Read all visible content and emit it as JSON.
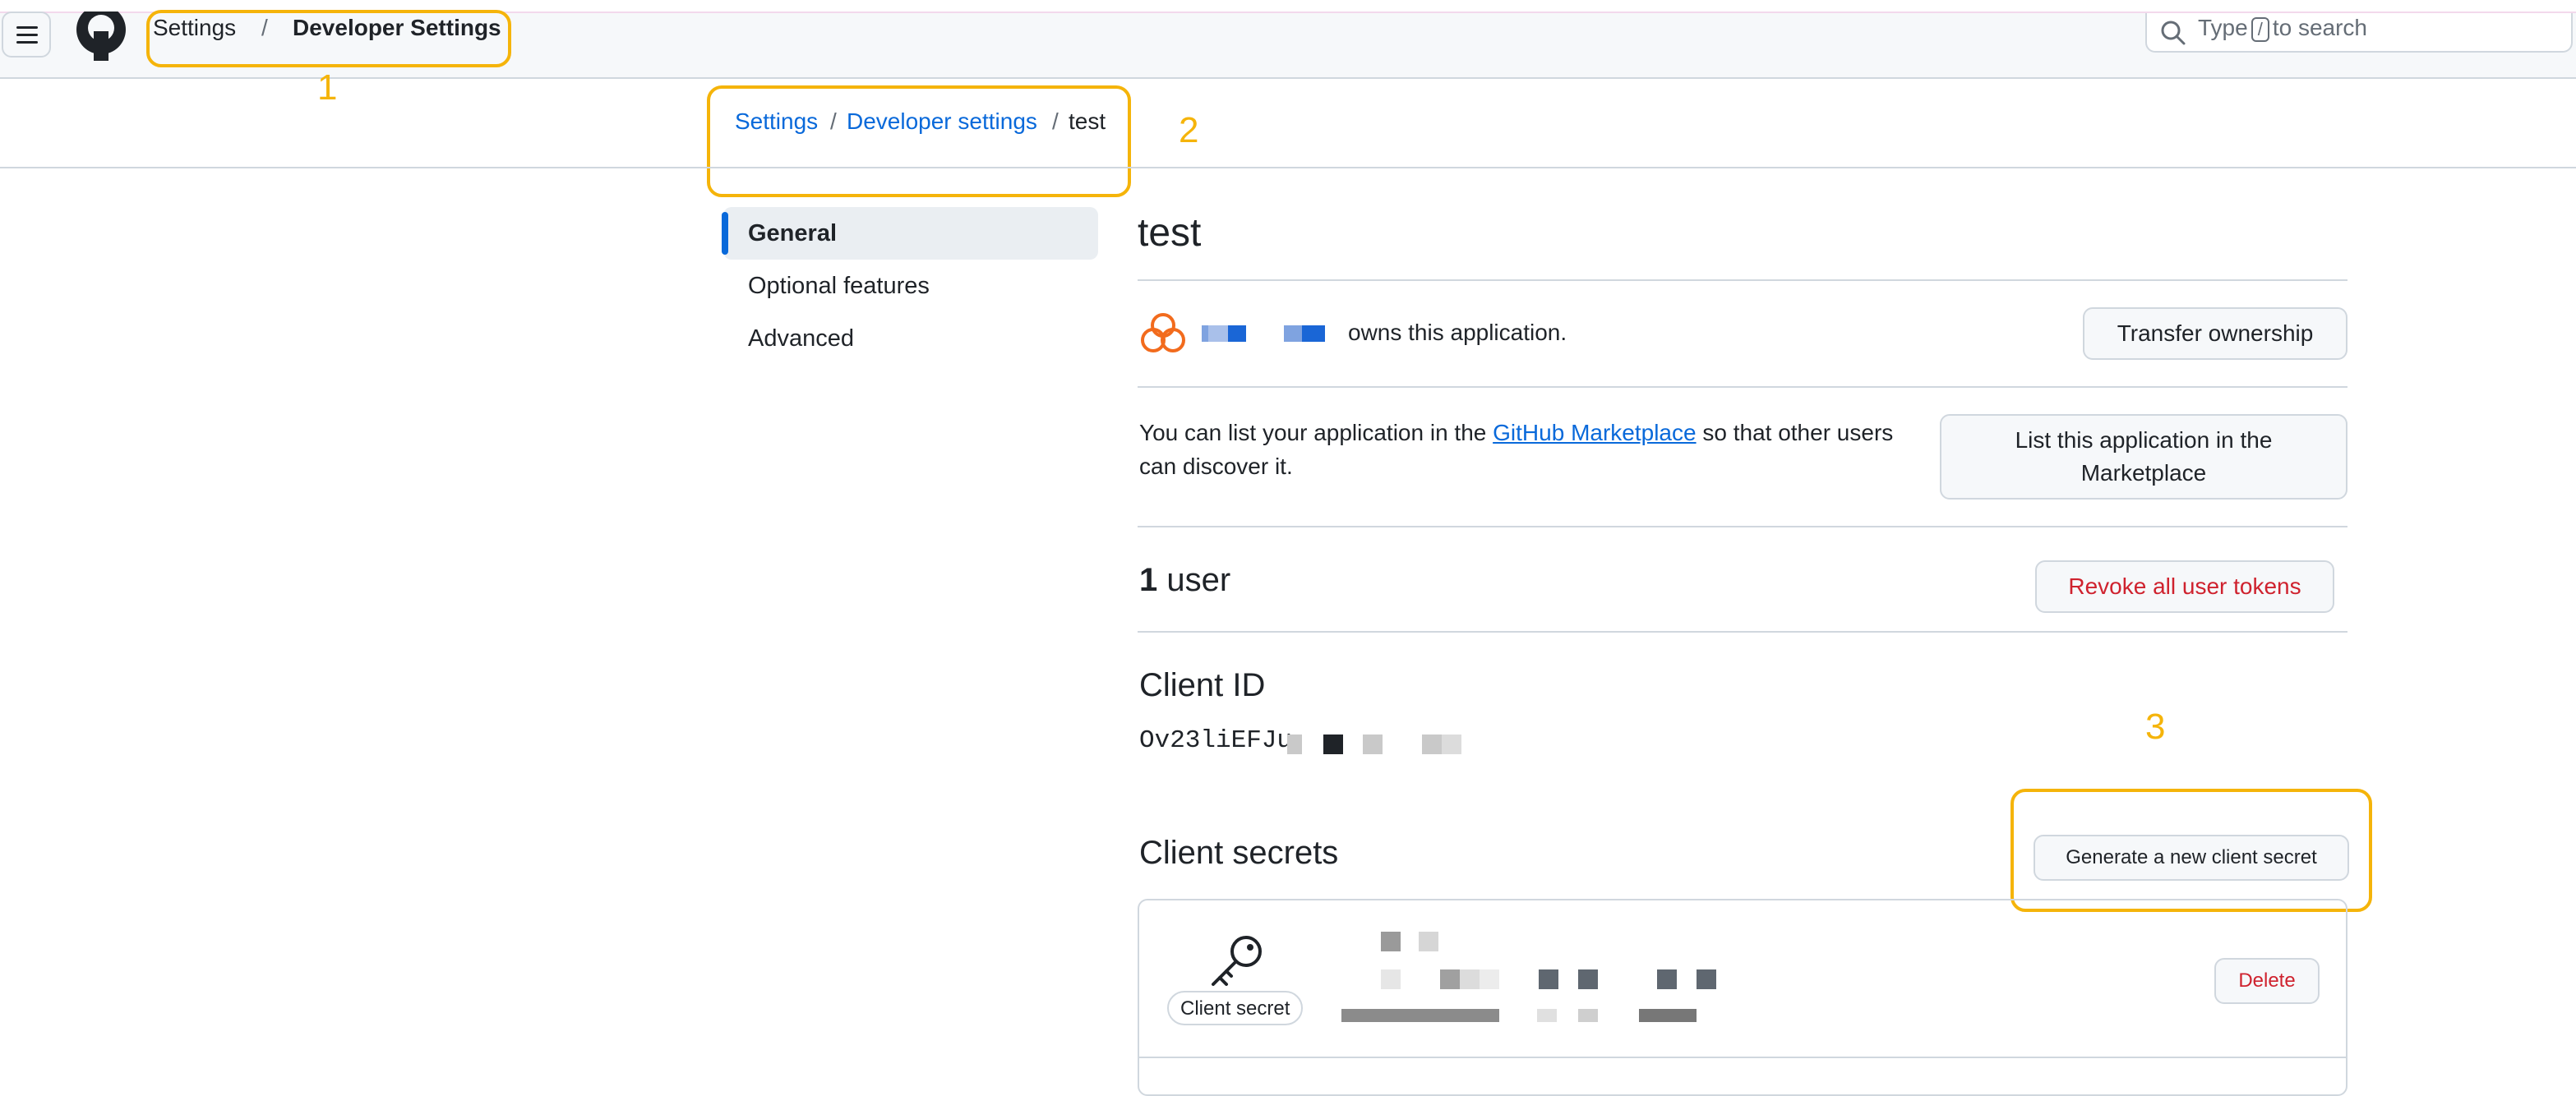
{
  "header": {
    "context_parent": "Settings",
    "context_separator": "/",
    "context_current": "Developer Settings",
    "search_prefix": "Type",
    "search_key": "/",
    "search_suffix": "to search"
  },
  "breadcrumb": {
    "items": [
      "Settings",
      "Developer settings",
      "test"
    ],
    "separator": "/"
  },
  "sidebar": {
    "items": [
      {
        "label": "General",
        "active": true
      },
      {
        "label": "Optional features"
      },
      {
        "label": "Advanced"
      }
    ]
  },
  "app": {
    "title": "test",
    "owns_text": "owns this application.",
    "transfer_label": "Transfer ownership",
    "marketplace_text_1": "You can list your application in the",
    "marketplace_link": "GitHub Marketplace",
    "marketplace_text_2": "so that other users",
    "marketplace_text_3": "can discover it.",
    "list_button_line1": "List this application in the",
    "list_button_line2": "Marketplace",
    "users_count": "1",
    "users_label": "user",
    "revoke_label": "Revoke all user tokens",
    "client_id_heading": "Client ID",
    "client_id_value": "Ov23liEFJu",
    "client_secrets_heading": "Client secrets",
    "generate_label": "Generate a new client secret",
    "secret_badge": "Client secret",
    "delete_label": "Delete"
  },
  "annotations": [
    "1",
    "2",
    "3"
  ],
  "colors": {
    "accent": "#0969da",
    "danger": "#cf222e",
    "annotation": "#f5b40a",
    "border": "#d0d7de"
  }
}
